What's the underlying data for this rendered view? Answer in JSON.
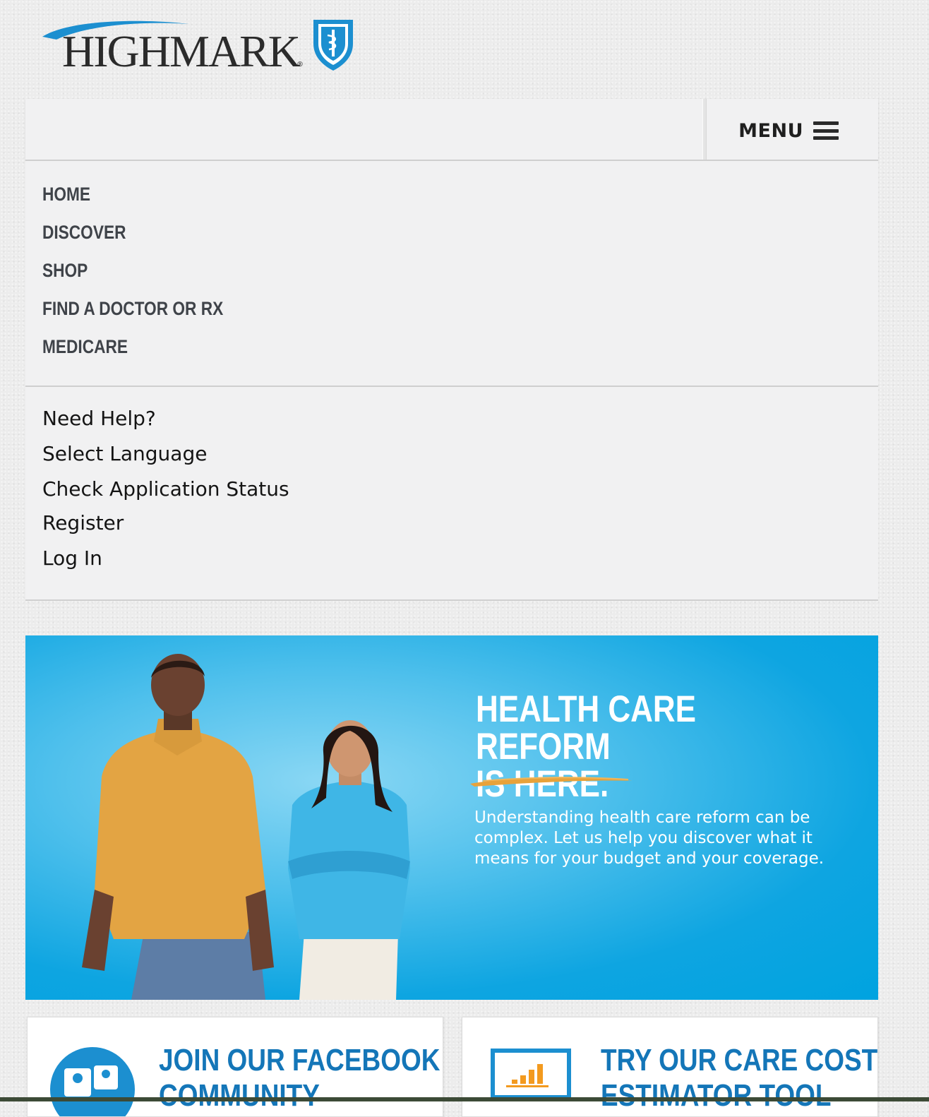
{
  "brand": {
    "name": "HIGHMARK",
    "registered": "®"
  },
  "header": {
    "menu_label": "MENU"
  },
  "nav": {
    "items": [
      {
        "label": "HOME"
      },
      {
        "label": "DISCOVER"
      },
      {
        "label": "SHOP"
      },
      {
        "label": "FIND A DOCTOR OR RX"
      },
      {
        "label": "MEDICARE"
      }
    ]
  },
  "utility": {
    "items": [
      {
        "label": "Need Help?"
      },
      {
        "label": "Select Language"
      },
      {
        "label": "Check Application Status"
      },
      {
        "label": "Register"
      },
      {
        "label": "Log In"
      }
    ]
  },
  "hero": {
    "title_line1": "HEALTH CARE REFORM",
    "title_line2": "IS HERE.",
    "body": "Understanding health care reform can be complex. Let us help you discover what it means for your budget and your coverage."
  },
  "cards": [
    {
      "title_line1": "JOIN OUR FACEBOOK",
      "title_line2": "COMMUNITY",
      "icon": "facebook-community-icon"
    },
    {
      "title_line1": "TRY OUR CARE COST",
      "title_line2": "ESTIMATOR TOOL",
      "icon": "bar-chart-icon"
    }
  ],
  "colors": {
    "brand_blue": "#1476b8",
    "hero_blue": "#00a3e0",
    "accent_orange": "#e8a23a"
  }
}
